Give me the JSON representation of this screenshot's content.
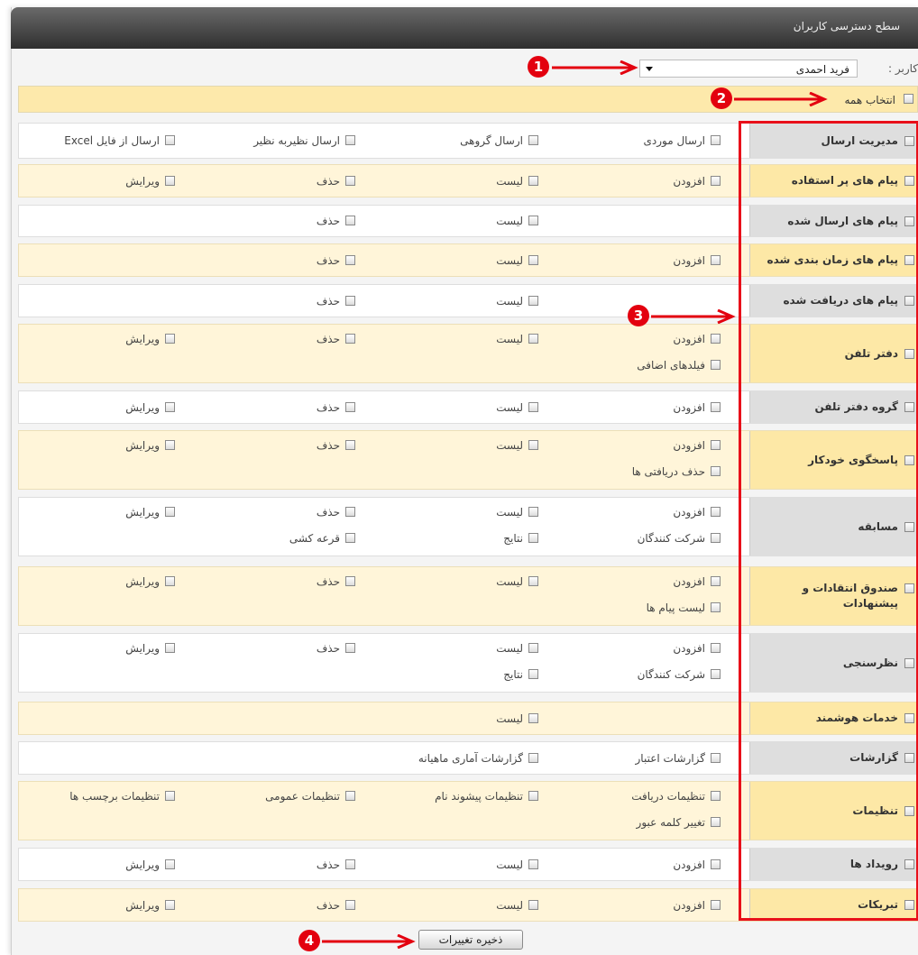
{
  "window": {
    "title": "سطح دسترسی کاربران"
  },
  "user": {
    "label": "کاربر :",
    "selected": "فرید احمدی"
  },
  "select_all": {
    "label": "انتخاب همه"
  },
  "sections": [
    {
      "label": "مدیریت ارسال",
      "items": [
        "ارسال موردی",
        "ارسال گروهی",
        "ارسال نظیربه نظیر",
        "ارسال از فایل Excel"
      ]
    },
    {
      "label": "پیام های پر استفاده",
      "items": [
        "افزودن",
        "لیست",
        "حذف",
        "ویرایش"
      ]
    },
    {
      "label": "پیام های ارسال شده",
      "items": [
        "",
        "لیست",
        "حذف",
        ""
      ]
    },
    {
      "label": "پیام های زمان بندی شده",
      "items": [
        "افزودن",
        "لیست",
        "حذف",
        ""
      ]
    },
    {
      "label": "پیام های دریافت شده",
      "items": [
        "",
        "لیست",
        "حذف",
        ""
      ]
    },
    {
      "label": "دفتر تلفن",
      "items": [
        "افزودن",
        "لیست",
        "حذف",
        "ویرایش",
        "فیلدهای اضافی"
      ]
    },
    {
      "label": "گروه دفتر تلفن",
      "items": [
        "افزودن",
        "لیست",
        "حذف",
        "ویرایش"
      ]
    },
    {
      "label": "پاسخگوی خودکار",
      "items": [
        "افزودن",
        "لیست",
        "حذف",
        "ویرایش",
        "حذف دریافتی ها"
      ]
    },
    {
      "label": "مسابقه",
      "items": [
        "افزودن",
        "لیست",
        "حذف",
        "ویرایش",
        "شرکت کنندگان",
        "نتایج",
        "قرعه کشی"
      ]
    },
    {
      "label": "صندوق انتقادات و پیشنهادات",
      "items": [
        "افزودن",
        "لیست",
        "حذف",
        "ویرایش",
        "لیست پیام ها"
      ]
    },
    {
      "label": "نظرسنجی",
      "items": [
        "افزودن",
        "لیست",
        "حذف",
        "ویرایش",
        "شرکت کنندگان",
        "نتایج"
      ]
    },
    {
      "label": "خدمات هوشمند",
      "items": [
        "",
        "لیست",
        "",
        ""
      ]
    },
    {
      "label": "گزارشات",
      "items": [
        "گزارشات اعتبار",
        "گزارشات آماری ماهیانه",
        "",
        ""
      ]
    },
    {
      "label": "تنظیمات",
      "items": [
        "تنظیمات دریافت",
        "تنظیمات پیشوند نام",
        "تنظیمات عمومی",
        "تنظیمات برچسب ها",
        "تغییر کلمه عبور"
      ]
    },
    {
      "label": "رویداد ها",
      "items": [
        "افزودن",
        "لیست",
        "حذف",
        "ویرایش"
      ]
    },
    {
      "label": "تبریکات",
      "items": [
        "افزودن",
        "لیست",
        "حذف",
        "ویرایش"
      ]
    }
  ],
  "save": {
    "label": "ذخیره تغییرات"
  },
  "annotations": {
    "badges": [
      "1",
      "2",
      "3",
      "4"
    ],
    "color": "#e3000f"
  }
}
